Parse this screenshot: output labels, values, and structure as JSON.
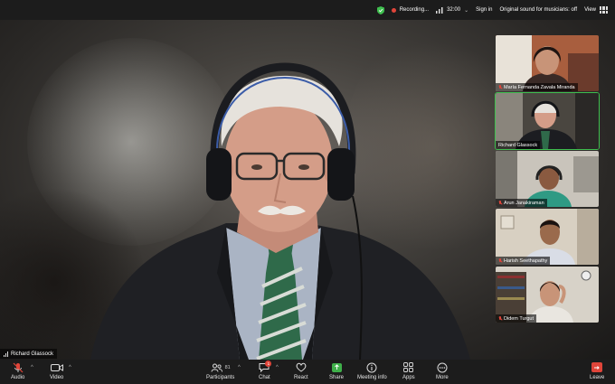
{
  "topbar": {
    "recording_label": "Recording...",
    "timer": "32:00",
    "sign_in": "Sign in",
    "original_sound": "Original sound for musicians: off",
    "view": "View",
    "accent_green": "#3fbf4f",
    "rec_color": "#e0453a"
  },
  "main_speaker": {
    "name": "Richard Glassock"
  },
  "participants": [
    {
      "name": "María Fernanda Zavala Miranda",
      "muted": true,
      "active": false
    },
    {
      "name": "Richard Glassock",
      "muted": false,
      "active": true
    },
    {
      "name": "Arun Janakiraman",
      "muted": true,
      "active": false
    },
    {
      "name": "Harish Seethapathy",
      "muted": true,
      "active": false
    },
    {
      "name": "Didem Turgut",
      "muted": true,
      "active": false
    }
  ],
  "toolbar": {
    "audio": "Audio",
    "video": "Video",
    "participants": "Participants",
    "participants_count": "81",
    "chat": "Chat",
    "chat_badge": "1",
    "react": "React",
    "share": "Share",
    "meeting_info": "Meeting info",
    "apps": "Apps",
    "more": "More",
    "leave": "Leave"
  }
}
